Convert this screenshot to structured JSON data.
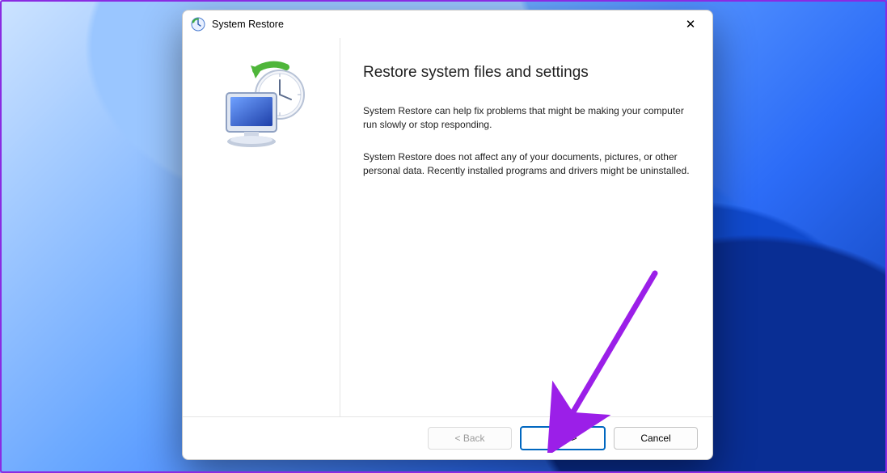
{
  "window": {
    "title": "System Restore"
  },
  "content": {
    "heading": "Restore system files and settings",
    "p1": "System Restore can help fix problems that might be making your computer run slowly or stop responding.",
    "p2": "System Restore does not affect any of your documents, pictures, or other personal data. Recently installed programs and drivers might be uninstalled."
  },
  "buttons": {
    "back": "< Back",
    "next": "Next >",
    "cancel": "Cancel"
  },
  "annotation": {
    "arrow_color": "#9b1fe8"
  }
}
